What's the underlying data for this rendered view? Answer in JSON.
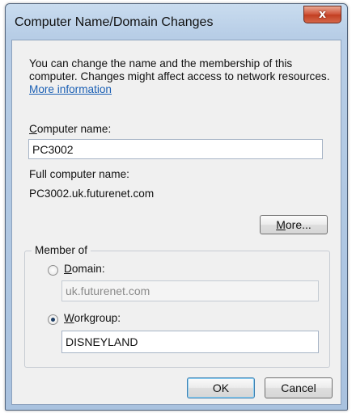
{
  "window": {
    "title": "Computer Name/Domain Changes",
    "close_glyph": "x"
  },
  "intro": {
    "text": "You can change the name and the membership of this computer. Changes might affect access to network resources.",
    "link": "More information"
  },
  "computer_name": {
    "label_first": "C",
    "label_rest": "omputer name:",
    "value": "PC3002"
  },
  "full_name": {
    "label": "Full computer name:",
    "value": "PC3002.uk.futurenet.com"
  },
  "more_button": {
    "label_first": "M",
    "label_rest": "ore..."
  },
  "member_of": {
    "legend": "Member of",
    "domain": {
      "label_first": "D",
      "label_rest": "omain:",
      "value": "uk.futurenet.com",
      "selected": false
    },
    "workgroup": {
      "label_first": "W",
      "label_rest": "orkgroup:",
      "value": "DISNEYLAND",
      "selected": true
    }
  },
  "buttons": {
    "ok": "OK",
    "cancel": "Cancel"
  }
}
